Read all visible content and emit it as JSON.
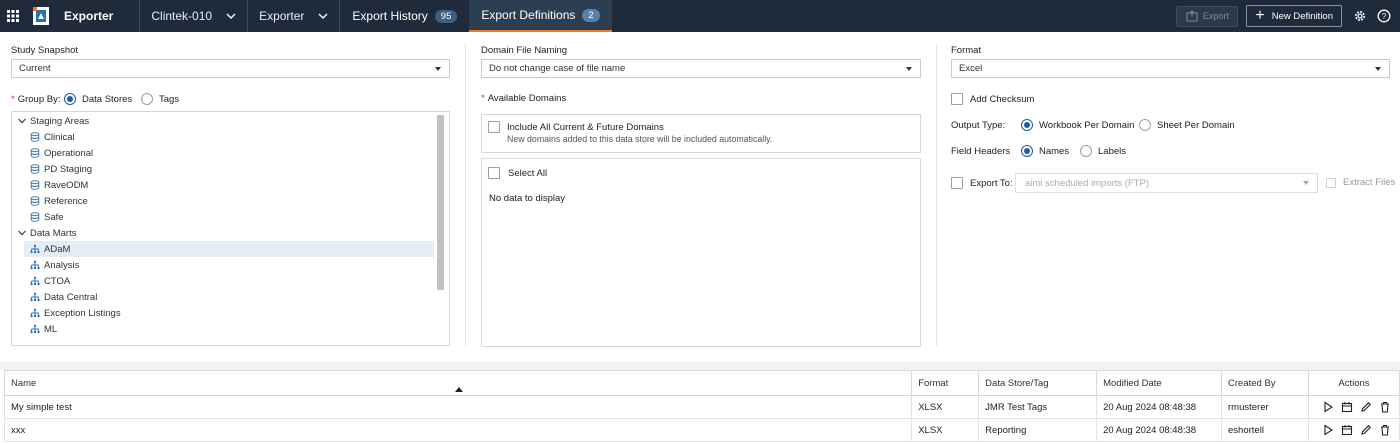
{
  "header": {
    "app_name": "Exporter",
    "study_select": "Clintek-010",
    "module_select": "Exporter",
    "tabs": [
      {
        "label": "Export History",
        "count": "95"
      },
      {
        "label": "Export Definitions",
        "count": "2"
      }
    ],
    "active_tab": "Export Definitions",
    "export_button": "Export",
    "new_definition_button": "New Definition"
  },
  "form": {
    "study_snapshot": {
      "label": "Study Snapshot",
      "value": "Current"
    },
    "group_by": {
      "label": "Group By:",
      "options": [
        "Data Stores",
        "Tags"
      ],
      "selected": "Data Stores"
    },
    "tree": {
      "groups": [
        {
          "label": "Staging Areas",
          "items": [
            "Clinical",
            "Operational",
            "PD Staging",
            "RaveODM",
            "Reference",
            "Safe"
          ]
        },
        {
          "label": "Data Marts",
          "items": [
            "ADaM",
            "Analysis",
            "CTOA",
            "Data Central",
            "Exception Listings",
            "ML"
          ]
        }
      ],
      "selected": "ADaM"
    },
    "domain_file_naming": {
      "label": "Domain File Naming",
      "value": "Do not change case of file name"
    },
    "available_domains": {
      "label": "Available Domains",
      "include_all_label": "Include All Current & Future Domains",
      "include_all_hint": "New domains added to this data store will be included automatically.",
      "select_all_label": "Select All",
      "empty_text": "No data to display"
    },
    "format": {
      "label": "Format",
      "value": "Excel"
    },
    "add_checksum": "Add Checksum",
    "output_type": {
      "label": "Output Type:",
      "options": [
        "Workbook Per Domain",
        "Sheet Per Domain"
      ],
      "selected": "Workbook Per Domain"
    },
    "field_headers": {
      "label": "Field Headers",
      "options": [
        "Names",
        "Labels"
      ],
      "selected": "Names"
    },
    "export_to": {
      "label": "Export To:",
      "value": "aimi scheduled imports (FTP)",
      "extract_files": "Extract Files"
    }
  },
  "table": {
    "columns": [
      "Name",
      "Format",
      "Data Store/Tag",
      "Modified Date",
      "Created By",
      "Actions"
    ],
    "rows": [
      {
        "name": "My simple test",
        "format": "XLSX",
        "store": "JMR Test Tags",
        "modified": "20 Aug 2024 08:48:38",
        "created_by": "rmusterer"
      },
      {
        "name": "xxx",
        "format": "XLSX",
        "store": "Reporting",
        "modified": "20 Aug 2024 08:48:38",
        "created_by": "eshortell"
      }
    ]
  },
  "colors": {
    "topbar": "#1f2b3a",
    "accent": "#f07c2a",
    "radio": "#1b5f9e"
  }
}
